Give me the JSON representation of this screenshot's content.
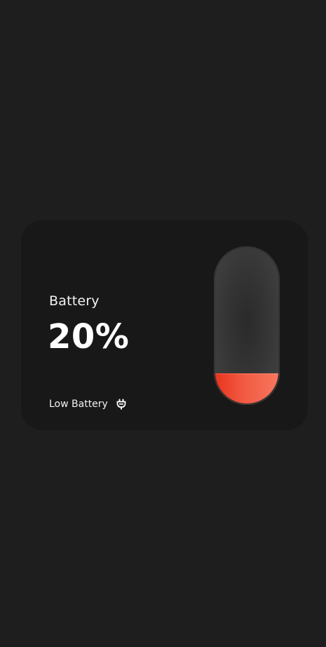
{
  "widget": {
    "label": "Battery",
    "percent_text": "20%",
    "status_text": "Low Battery",
    "status_icon": "plug-icon",
    "level_fraction": 0.2
  },
  "colors": {
    "background": "#1e1e1e",
    "card": "#181818",
    "text": "#ffffff",
    "battery_body": "#3a3a3a",
    "fill_start": "#e8321c",
    "fill_end": "#f7775e"
  }
}
